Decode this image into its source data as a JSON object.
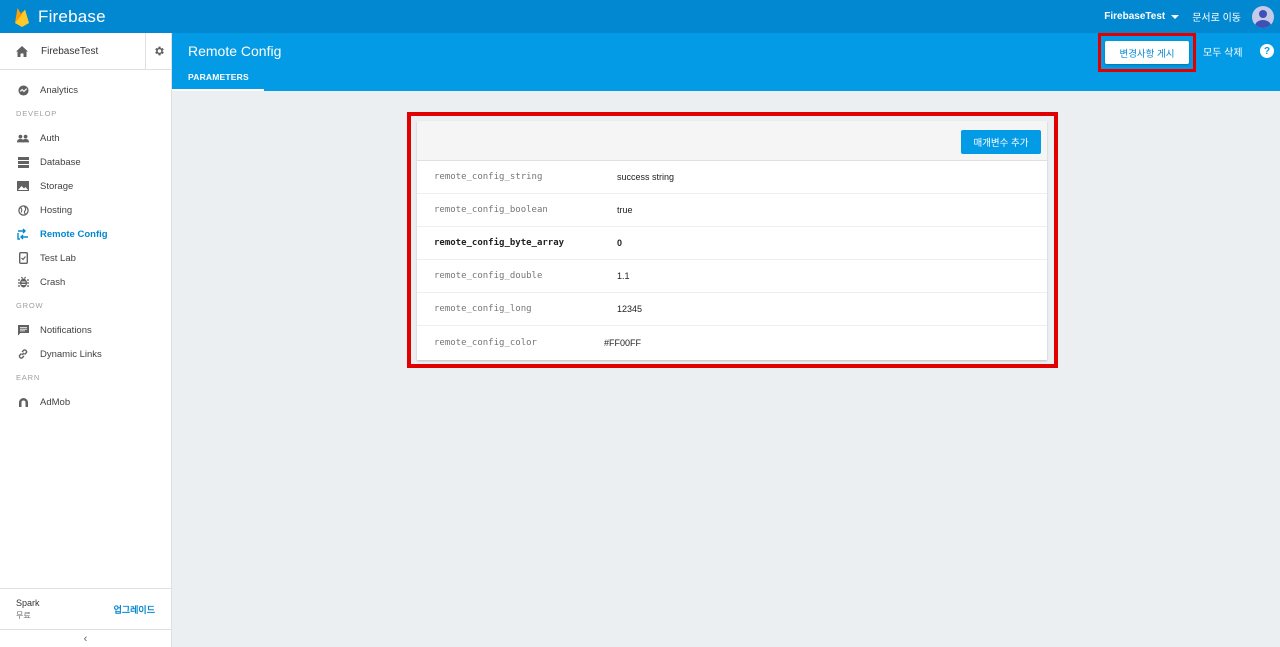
{
  "topbar": {
    "brand": "Firebase",
    "project": "FirebaseTest",
    "docs": "문서로 이동"
  },
  "sidebar": {
    "project": "FirebaseTest",
    "analytics": "Analytics",
    "sections": {
      "develop": "DEVELOP",
      "grow": "GROW",
      "earn": "EARN"
    },
    "develop_items": [
      "Auth",
      "Database",
      "Storage",
      "Hosting",
      "Remote Config",
      "Test Lab",
      "Crash"
    ],
    "grow_items": [
      "Notifications",
      "Dynamic Links"
    ],
    "earn_items": [
      "AdMob"
    ],
    "plan": {
      "name": "Spark",
      "tier": "무료",
      "upgrade": "업그레이드"
    },
    "collapse_glyph": "‹"
  },
  "header": {
    "title": "Remote Config",
    "tab": "PARAMETERS",
    "publish": "변경사항 게시",
    "discard": "모두 삭제",
    "help": "?"
  },
  "card": {
    "add_button": "매개변수 추가",
    "rows": [
      {
        "key": "remote_config_string",
        "value": "success string"
      },
      {
        "key": "remote_config_boolean",
        "value": "true"
      },
      {
        "key": "remote_config_byte_array",
        "value": "0"
      },
      {
        "key": "remote_config_double",
        "value": "1.1"
      },
      {
        "key": "remote_config_long",
        "value": "12345"
      },
      {
        "key": "remote_config_color",
        "value": "#FF00FF"
      }
    ]
  },
  "colors": {
    "topbar": "#0288d1",
    "header": "#039be5",
    "highlight": "#e00000",
    "accent": "#0288d1"
  }
}
